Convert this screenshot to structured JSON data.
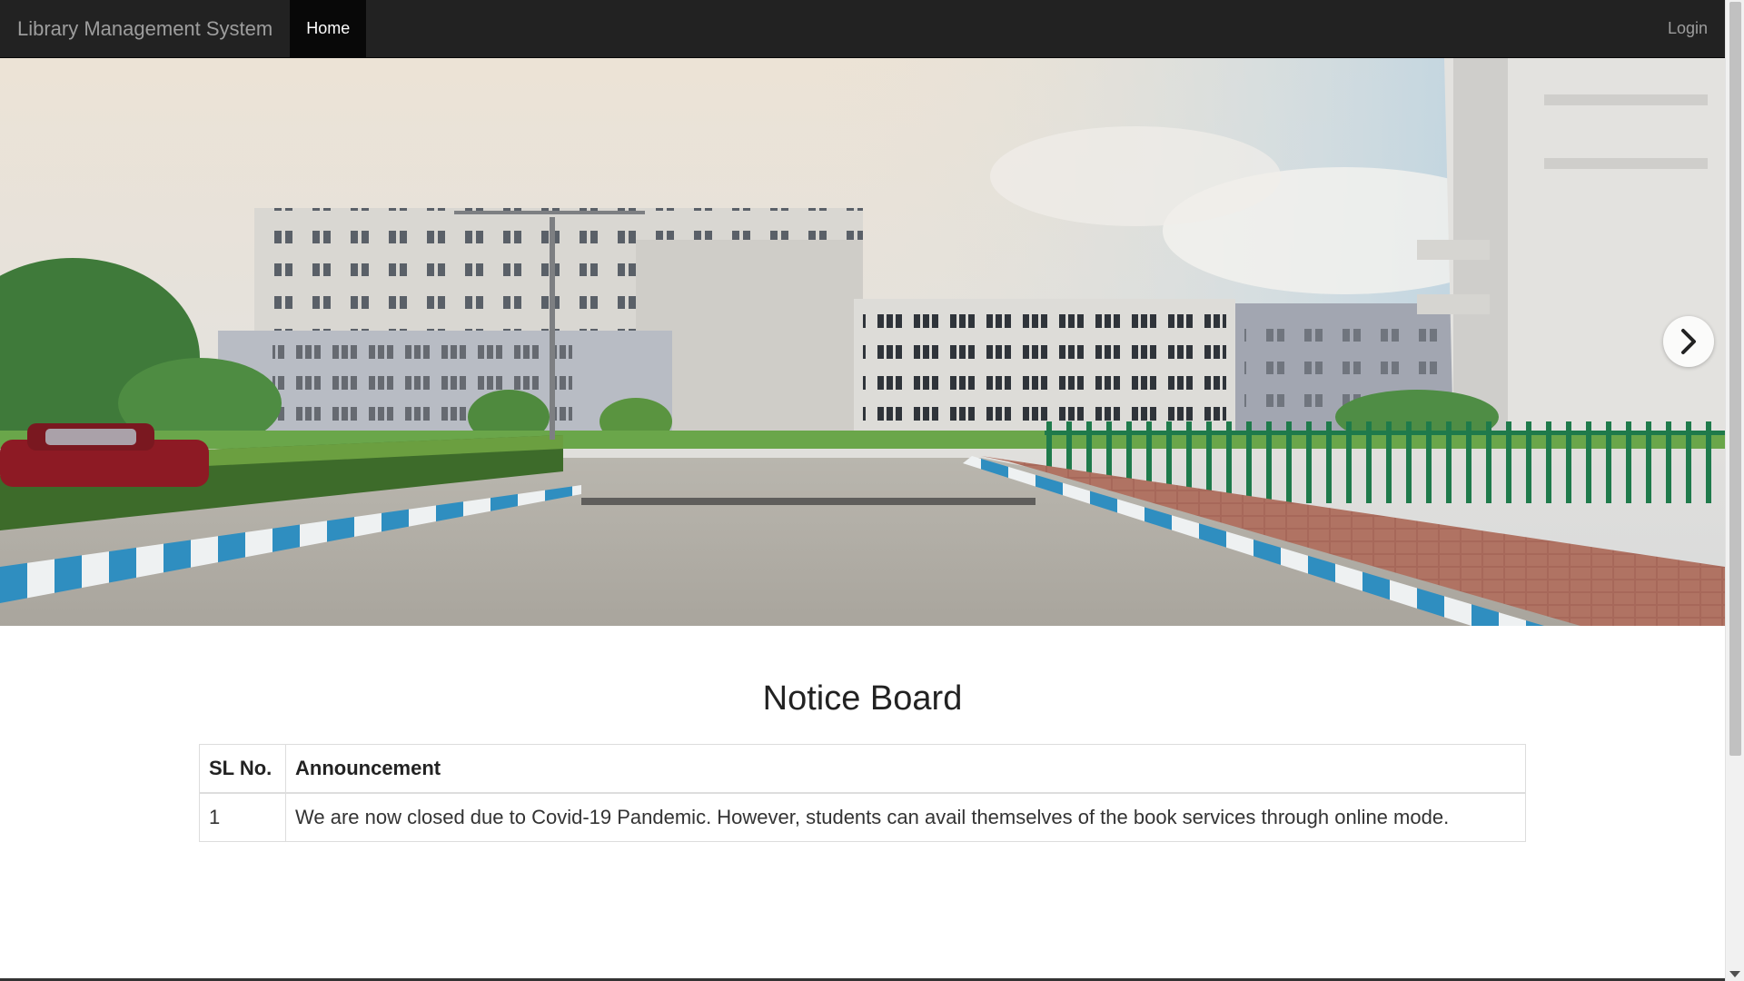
{
  "navbar": {
    "brand": "Library Management System",
    "items": [
      {
        "label": "Home",
        "active": true
      }
    ],
    "login_label": "Login"
  },
  "carousel": {
    "image_subject": "campus-buildings-photo",
    "next_icon": "chevron-right-icon"
  },
  "notice_board": {
    "title": "Notice Board",
    "columns": [
      "SL No.",
      "Announcement"
    ],
    "rows": [
      [
        "1",
        "We are now closed due to Covid-19 Pandemic. However, students can avail themselves of the book services through online mode."
      ]
    ]
  },
  "colors": {
    "navbar_bg": "#222222",
    "navbar_active_bg": "#080808",
    "navbar_text": "#9d9d9d",
    "table_border": "#dddddd"
  }
}
